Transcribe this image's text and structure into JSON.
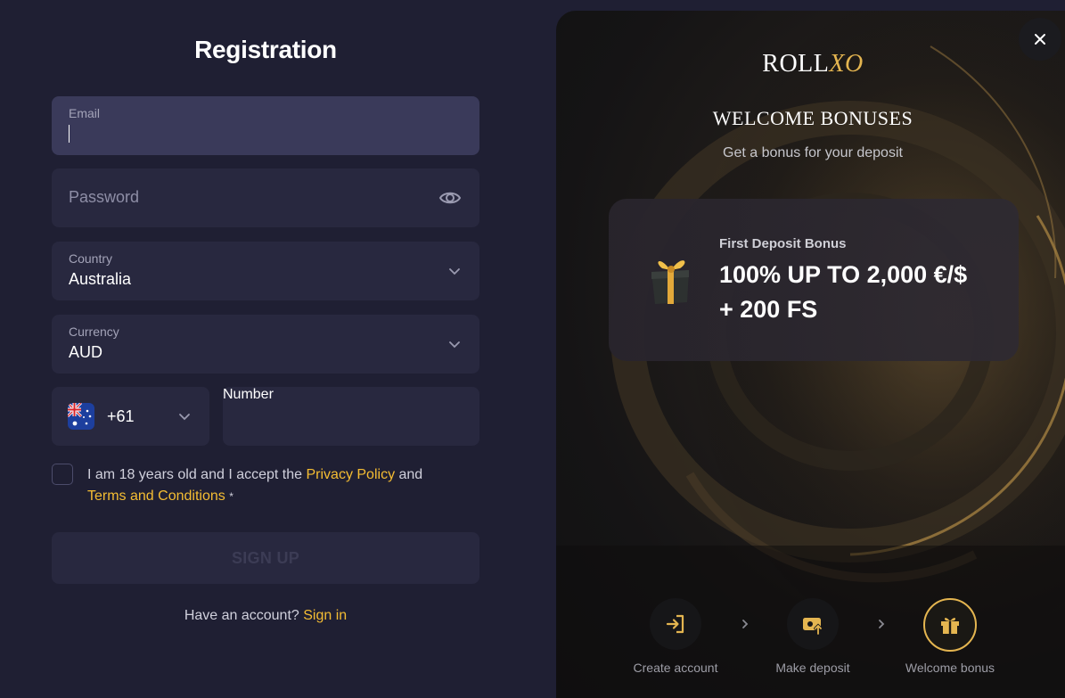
{
  "registration": {
    "title": "Registration",
    "email": {
      "label": "Email",
      "value": ""
    },
    "password": {
      "placeholder": "Password"
    },
    "country": {
      "label": "Country",
      "value": "Australia"
    },
    "currency": {
      "label": "Currency",
      "value": "AUD"
    },
    "phone": {
      "code": "+61",
      "placeholder": "Number"
    },
    "terms": {
      "prefix": "I am 18 years old and I accept the ",
      "privacy_link": "Privacy Policy",
      "and": " and",
      "terms_link": "Terms and Conditions",
      "required_mark": "*"
    },
    "signup_label": "SIGN UP",
    "have_account": "Have an account?",
    "signin_link": "Sign in"
  },
  "promo": {
    "logo_roll": "ROLL",
    "logo_xo": "XO",
    "welcome_title": "WELCOME BONUSES",
    "subtitle": "Get a bonus for your deposit",
    "bonus": {
      "label": "First Deposit Bonus",
      "line1": "100% UP TO 2,000 €/$",
      "line2": "+ 200 FS"
    },
    "steps": [
      {
        "label": "Create account",
        "icon": "sign-in-icon"
      },
      {
        "label": "Make deposit",
        "icon": "wallet-icon"
      },
      {
        "label": "Welcome bonus",
        "icon": "gift-icon"
      }
    ]
  },
  "colors": {
    "accent": "#f5bd33",
    "field_bg": "#28283f",
    "page_bg": "#1f1f33"
  }
}
